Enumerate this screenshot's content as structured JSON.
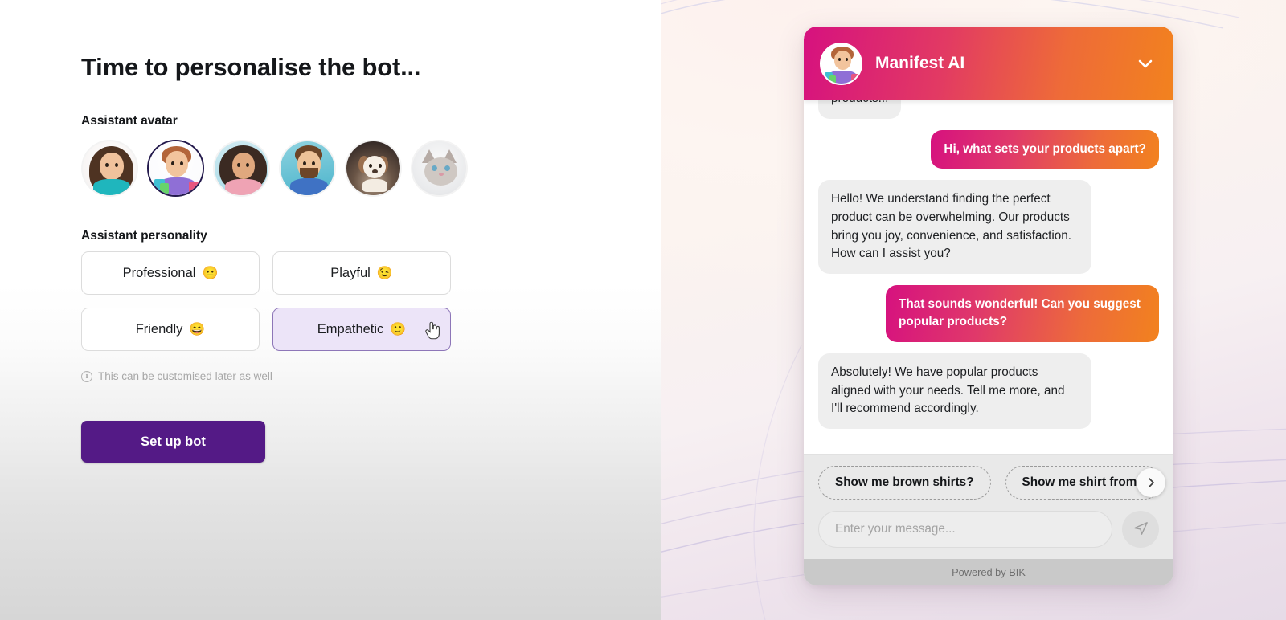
{
  "page": {
    "title": "Time to personalise the bot..."
  },
  "avatar_section": {
    "label": "Assistant avatar",
    "selected_index": 1,
    "selection_ring_color": "#241a4d",
    "options": [
      {
        "name": "woman-brown-hair-teal-top-avatar",
        "alt": "Woman with long brown hair wearing teal top"
      },
      {
        "name": "man-shopping-bags-purple-shirt-avatar",
        "alt": "Man with curly hair holding shopping bags, purple shirt"
      },
      {
        "name": "woman-curly-hair-pink-top-avatar",
        "alt": "Woman with curly dark hair in pink top"
      },
      {
        "name": "man-beard-blue-shirt-avatar",
        "alt": "Bearded man in blue shirt"
      },
      {
        "name": "puppy-avatar",
        "alt": "Brown and white puppy"
      },
      {
        "name": "cat-avatar",
        "alt": "Grey fluffy cat"
      }
    ]
  },
  "personality_section": {
    "label": "Assistant personality",
    "selected": "Empathetic",
    "selected_bg": "#ece4f8",
    "selected_border": "#8d76b8",
    "options": [
      {
        "label": "Professional",
        "emoji": "😐"
      },
      {
        "label": "Playful",
        "emoji": "😉"
      },
      {
        "label": "Friendly",
        "emoji": "😄"
      },
      {
        "label": "Empathetic",
        "emoji": "🙂"
      }
    ]
  },
  "hint": {
    "icon": "info-icon",
    "text": "This can be customised later as well"
  },
  "cta": {
    "label": "Set up bot",
    "color": "#541a86"
  },
  "chat_widget": {
    "header": {
      "title": "Manifest AI",
      "avatar": "bot-avatar",
      "collapse_icon": "chevron-down-icon",
      "gradient_from": "#d6117f",
      "gradient_to": "#f2821e"
    },
    "messages": [
      {
        "sender": "bot",
        "text": "products...",
        "clipped": true
      },
      {
        "sender": "user",
        "text": "Hi, what sets your products apart?"
      },
      {
        "sender": "bot",
        "text": "Hello! We understand finding the perfect product can be overwhelming. Our products bring you joy, convenience, and satisfaction. How can I assist you?"
      },
      {
        "sender": "user",
        "text": "That sounds wonderful! Can you suggest popular products?"
      },
      {
        "sender": "bot",
        "text": "Absolutely! We have popular products aligned with your needs. Tell me more, and I'll recommend accordingly."
      }
    ],
    "suggestion_chips": [
      "Show me brown shirts?",
      "Show me shirt from t"
    ],
    "chips_next_icon": "chevron-right-icon",
    "composer": {
      "placeholder": "Enter your message...",
      "value": "",
      "send_icon": "send-icon"
    },
    "footer": "Powered by BIK"
  }
}
